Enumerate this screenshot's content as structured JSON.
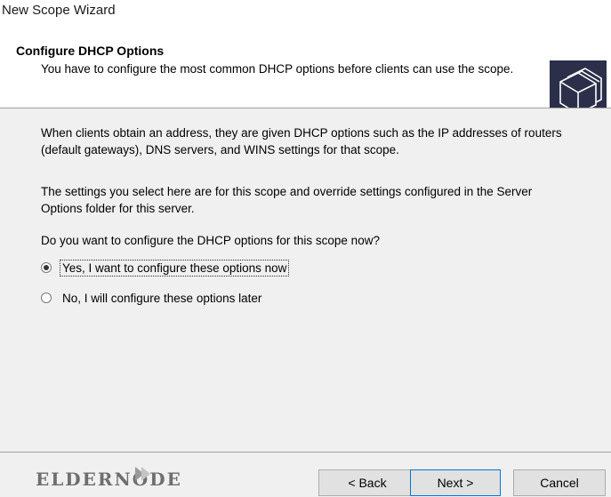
{
  "window": {
    "title": "New Scope Wizard"
  },
  "header": {
    "heading": "Configure DHCP Options",
    "subheading": "You have to configure the most common DHCP options before clients can use the scope.",
    "icon": "folders-icon"
  },
  "body": {
    "paragraph1": "When clients obtain an address, they are given DHCP options such as the IP addresses of routers (default gateways), DNS servers, and WINS settings for that scope.",
    "paragraph2": "The settings you select here are for this scope and override settings configured in the Server Options folder for this server.",
    "question": "Do you want to configure the DHCP options for this scope now?",
    "options": [
      {
        "label": "Yes, I want to configure these options now",
        "selected": true
      },
      {
        "label": "No, I will configure these options later",
        "selected": false
      }
    ]
  },
  "footer": {
    "brand": "eldernode",
    "back_label": "< Back",
    "next_label": "Next >",
    "cancel_label": "Cancel"
  },
  "colors": {
    "header_bg": "#ffffff",
    "content_bg": "#f0f0f0",
    "icon_bg": "#2b2f4a",
    "default_button_border": "#0078d7"
  }
}
